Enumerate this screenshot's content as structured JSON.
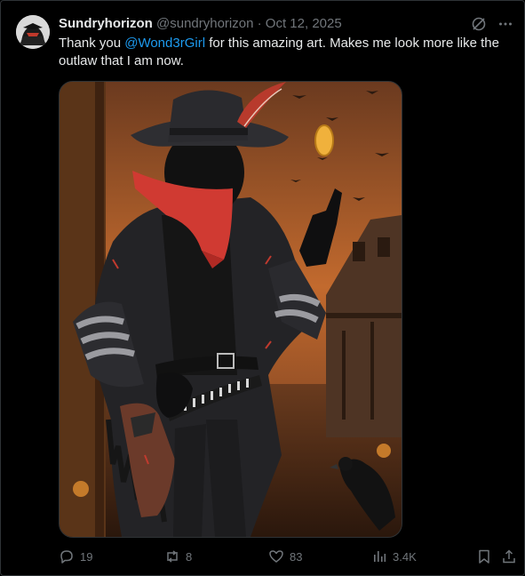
{
  "tweet": {
    "display_name": "Sundryhorizon",
    "handle": "@sundryhorizon",
    "separator": "·",
    "date": "Oct 12, 2025",
    "text_before": "Thank you ",
    "mention": "@Wond3rGirl",
    "text_after": " for this amazing art. Makes me look more like the outlaw that I am now.",
    "media_icon": "cowboy-outlaw-illustration"
  },
  "top_icons": [
    "grok-icon",
    "more-icon"
  ],
  "actions": {
    "replies": "19",
    "reposts": "8",
    "likes": "83",
    "views": "3.4K"
  },
  "colors": {
    "background": "#000000",
    "text": "#e7e9ea",
    "secondary": "#71767b",
    "accent": "#1d9bf0",
    "border": "#2f3336"
  }
}
